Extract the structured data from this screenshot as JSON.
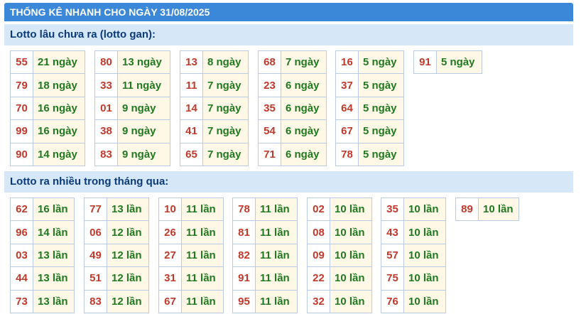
{
  "title": "THỐNG KÊ NHANH CHO NGÀY 31/08/2025",
  "section1": {
    "header": "Lotto lâu chưa ra (lotto gan):",
    "columns": [
      [
        {
          "n": "55",
          "c": "21 ngày"
        },
        {
          "n": "79",
          "c": "18 ngày"
        },
        {
          "n": "70",
          "c": "16 ngày"
        },
        {
          "n": "99",
          "c": "16 ngày"
        },
        {
          "n": "90",
          "c": "14 ngày"
        }
      ],
      [
        {
          "n": "80",
          "c": "13 ngày"
        },
        {
          "n": "33",
          "c": "11 ngày"
        },
        {
          "n": "01",
          "c": "9 ngày"
        },
        {
          "n": "38",
          "c": "9 ngày"
        },
        {
          "n": "83",
          "c": "9 ngày"
        }
      ],
      [
        {
          "n": "13",
          "c": "8 ngày"
        },
        {
          "n": "11",
          "c": "7 ngày"
        },
        {
          "n": "14",
          "c": "7 ngày"
        },
        {
          "n": "41",
          "c": "7 ngày"
        },
        {
          "n": "65",
          "c": "7 ngày"
        }
      ],
      [
        {
          "n": "68",
          "c": "7 ngày"
        },
        {
          "n": "23",
          "c": "6 ngày"
        },
        {
          "n": "35",
          "c": "6 ngày"
        },
        {
          "n": "54",
          "c": "6 ngày"
        },
        {
          "n": "71",
          "c": "6 ngày"
        }
      ],
      [
        {
          "n": "16",
          "c": "5 ngày"
        },
        {
          "n": "37",
          "c": "5 ngày"
        },
        {
          "n": "64",
          "c": "5 ngày"
        },
        {
          "n": "67",
          "c": "5 ngày"
        },
        {
          "n": "78",
          "c": "5 ngày"
        }
      ],
      [
        {
          "n": "91",
          "c": "5 ngày"
        }
      ]
    ]
  },
  "section2": {
    "header": "Lotto ra nhiều trong tháng qua:",
    "columns": [
      [
        {
          "n": "62",
          "c": "16 lần"
        },
        {
          "n": "96",
          "c": "14 lần"
        },
        {
          "n": "03",
          "c": "13 lần"
        },
        {
          "n": "44",
          "c": "13 lần"
        },
        {
          "n": "73",
          "c": "13 lần"
        }
      ],
      [
        {
          "n": "77",
          "c": "13 lần"
        },
        {
          "n": "06",
          "c": "12 lần"
        },
        {
          "n": "49",
          "c": "12 lần"
        },
        {
          "n": "51",
          "c": "12 lần"
        },
        {
          "n": "83",
          "c": "12 lần"
        }
      ],
      [
        {
          "n": "10",
          "c": "11 lần"
        },
        {
          "n": "26",
          "c": "11 lần"
        },
        {
          "n": "27",
          "c": "11 lần"
        },
        {
          "n": "31",
          "c": "11 lần"
        },
        {
          "n": "67",
          "c": "11 lần"
        }
      ],
      [
        {
          "n": "78",
          "c": "11 lần"
        },
        {
          "n": "81",
          "c": "11 lần"
        },
        {
          "n": "82",
          "c": "11 lần"
        },
        {
          "n": "91",
          "c": "11 lần"
        },
        {
          "n": "95",
          "c": "11 lần"
        }
      ],
      [
        {
          "n": "02",
          "c": "10 lần"
        },
        {
          "n": "08",
          "c": "10 lần"
        },
        {
          "n": "09",
          "c": "10 lần"
        },
        {
          "n": "22",
          "c": "10 lần"
        },
        {
          "n": "32",
          "c": "10 lần"
        }
      ],
      [
        {
          "n": "35",
          "c": "10 lần"
        },
        {
          "n": "43",
          "c": "10 lần"
        },
        {
          "n": "57",
          "c": "10 lần"
        },
        {
          "n": "75",
          "c": "10 lần"
        },
        {
          "n": "76",
          "c": "10 lần"
        }
      ],
      [
        {
          "n": "89",
          "c": "10 lần"
        }
      ]
    ]
  }
}
